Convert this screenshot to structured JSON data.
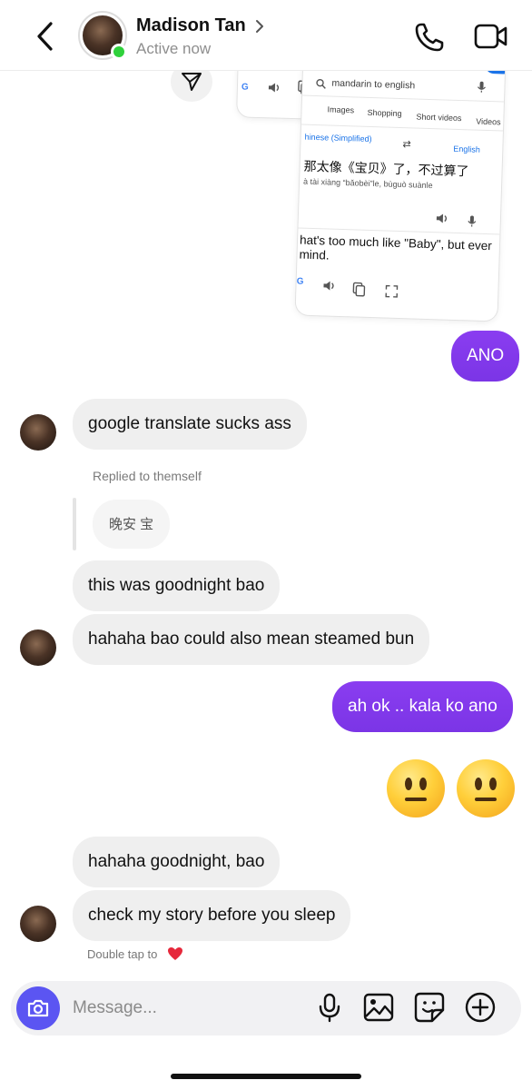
{
  "header": {
    "contact_name": "Madison Tan",
    "status": "Active now"
  },
  "shared_screenshot": {
    "search_query": "mandarin to english",
    "tabs": [
      "Images",
      "Shopping",
      "Short videos",
      "Videos"
    ],
    "source_lang": "hinese (Simplified)",
    "target_lang": "English",
    "source_text": "那太像《宝贝》了，不过算了",
    "pinyin": "à tài xiàng “bǎobèi”le, bùguò suànle",
    "translation": "hat's too much like \"Baby\", but ever mind."
  },
  "messages": [
    {
      "id": "m1",
      "sender": "me",
      "text": "ANO"
    },
    {
      "id": "m2",
      "sender": "them",
      "text": "google translate sucks ass"
    },
    {
      "id": "m3",
      "sender": "them",
      "reply_label": "Replied to themself",
      "quoted": "晚安 宝"
    },
    {
      "id": "m4",
      "sender": "them",
      "text": "this was goodnight bao"
    },
    {
      "id": "m5",
      "sender": "them",
      "text": "hahaha bao could also mean steamed bun"
    },
    {
      "id": "m6",
      "sender": "me",
      "text": "ah ok .. kala ko ano"
    },
    {
      "id": "m7",
      "sender": "me",
      "emoji": "neutral-face x2"
    },
    {
      "id": "m8",
      "sender": "them",
      "text": "hahaha goodnight, bao"
    },
    {
      "id": "m9",
      "sender": "them",
      "text": "check my story before you sleep"
    }
  ],
  "double_tap_hint": "Double tap to",
  "composer": {
    "placeholder": "Message..."
  },
  "colors": {
    "outgoing_bubble": "#7c3aed",
    "incoming_bubble": "#efefef",
    "online": "#2fd13b",
    "camera_button": "#5b55f2"
  },
  "icons": [
    "back-arrow-icon",
    "chevron-right-icon",
    "phone-icon",
    "video-camera-icon",
    "send-icon",
    "camera-icon",
    "microphone-icon",
    "gallery-icon",
    "sticker-icon",
    "plus-icon",
    "heart-icon"
  ]
}
